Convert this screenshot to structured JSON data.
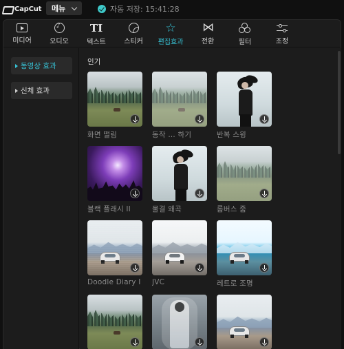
{
  "app": {
    "logo_text": "CapCut",
    "menu_label": "메뉴",
    "save_status": "자동 저장: 15:41:28"
  },
  "tabs": [
    {
      "label": "미디어",
      "icon": "media-icon",
      "active": false
    },
    {
      "label": "오디오",
      "icon": "audio-icon",
      "active": false
    },
    {
      "label": "텍스트",
      "icon": "text-icon",
      "active": false
    },
    {
      "label": "스티커",
      "icon": "sticker-icon",
      "active": false
    },
    {
      "label": "편집효과",
      "icon": "effects-icon",
      "active": true
    },
    {
      "label": "전환",
      "icon": "transition-icon",
      "active": false
    },
    {
      "label": "필터",
      "icon": "filter-icon",
      "active": false
    },
    {
      "label": "조정",
      "icon": "adjust-icon",
      "active": false
    }
  ],
  "sidebar": {
    "items": [
      {
        "label": "동영상 효과",
        "active": true
      },
      {
        "label": "신체 효과",
        "active": false
      }
    ]
  },
  "content": {
    "section_title": "인기",
    "items": [
      {
        "label": "화면 떨림",
        "thumb": "meadow"
      },
      {
        "label": "동작 … 하기",
        "thumb": "meadow-haze"
      },
      {
        "label": "반복 스윙",
        "thumb": "portrait"
      },
      {
        "label": "블랙 플래시 II",
        "thumb": "concert"
      },
      {
        "label": "물결 왜곡",
        "thumb": "portrait"
      },
      {
        "label": "롬버스 줌",
        "thumb": "meadow-haze"
      },
      {
        "label": "Doodle Diary I",
        "thumb": "beach"
      },
      {
        "label": "JVC",
        "thumb": "beach-bw"
      },
      {
        "label": "레트로 조명",
        "thumb": "beach-cool"
      },
      {
        "label": "",
        "thumb": "meadow"
      },
      {
        "label": "",
        "thumb": "ghost"
      },
      {
        "label": "",
        "thumb": "beach"
      }
    ]
  },
  "colors": {
    "accent": "#37c3d6",
    "background": "#101010",
    "panel": "#1c1c1c"
  }
}
